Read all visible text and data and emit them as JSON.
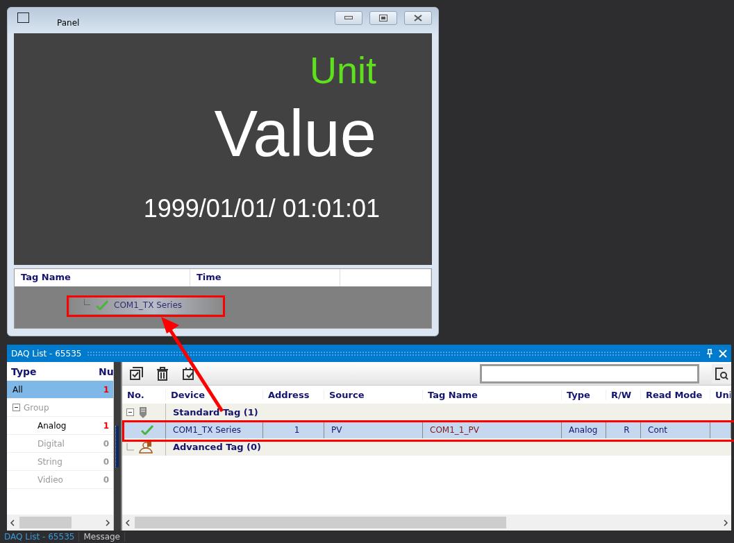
{
  "panel_window": {
    "title": "Panel",
    "unit": "Unit",
    "value": "Value",
    "timestamp": "1999/01/01/ 01:01:01",
    "alarm_table": {
      "columns": [
        "Tag Name",
        "Time"
      ],
      "rows": [
        {
          "name": "COM1_TX Series",
          "ok": true
        }
      ]
    }
  },
  "daq_list": {
    "title": "DAQ List - 65535",
    "type_tree": {
      "columns": [
        "Type",
        "Nu"
      ],
      "items": [
        {
          "label": "All",
          "count": "1",
          "selected": true,
          "disabled": false
        },
        {
          "label": "Group",
          "selected": false,
          "disabled": true,
          "expanded": true,
          "children": [
            {
              "label": "Analog",
              "count": "1",
              "selected": false,
              "disabled": false
            },
            {
              "label": "Digital",
              "count": "0",
              "selected": false,
              "disabled": true
            },
            {
              "label": "String",
              "count": "0",
              "selected": false,
              "disabled": true
            },
            {
              "label": "Vidieo",
              "count": "0",
              "selected": false,
              "disabled": true
            }
          ]
        }
      ]
    },
    "tag_table": {
      "columns": [
        "No.",
        "Device",
        "Address",
        "Source",
        "Tag Name",
        "Type",
        "R/W",
        "Read Mode",
        "Uni"
      ],
      "groups": [
        {
          "kind": "standard",
          "label": "Standard Tag (1)",
          "expanded": true,
          "rows": [
            {
              "selected": true,
              "ok": true,
              "cells": [
                "COM1_TX Series",
                "1",
                "PV",
                "COM1_1_PV",
                "Analog",
                "R",
                "Cont"
              ]
            }
          ]
        },
        {
          "kind": "advanced",
          "label": "Advanced Tag (0)",
          "expanded": false
        }
      ]
    }
  },
  "status_bar": {
    "tabs": [
      {
        "label": "DAQ List - 65535",
        "selected": true
      },
      {
        "label": "Message",
        "selected": false
      }
    ]
  }
}
